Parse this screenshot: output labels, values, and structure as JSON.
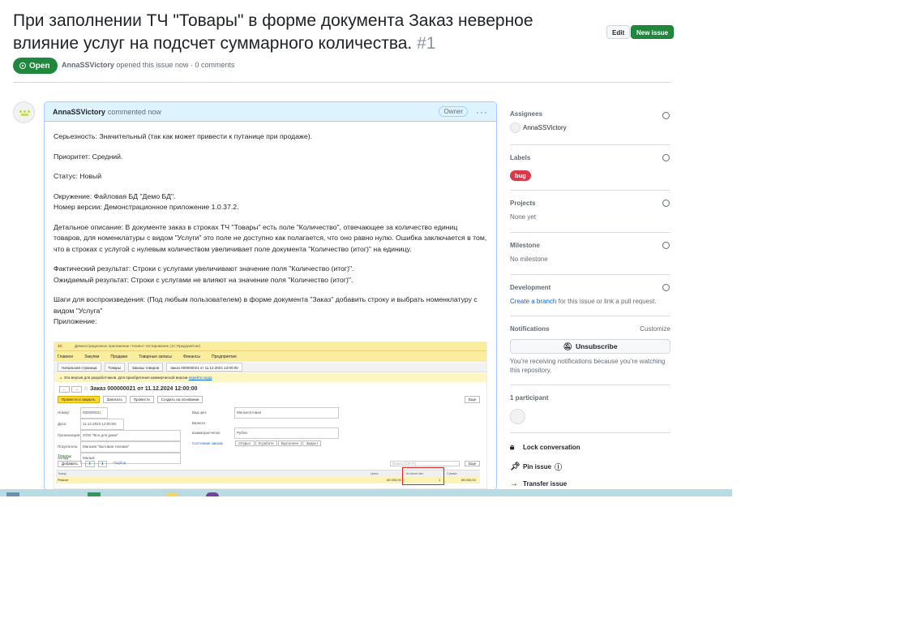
{
  "issue": {
    "title": "При заполнении ТЧ \"Товары\" в форме документа Заказ неверное влияние услуг на подсчет суммарного количества.",
    "number": "#1",
    "state": "Open",
    "author": "AnnaSSVictory",
    "meta": "opened this issue now · 0 comments"
  },
  "header_buttons": {
    "edit": "Edit",
    "new_issue": "New issue"
  },
  "comment": {
    "author": "AnnaSSVictory",
    "time": "commented now",
    "role": "Owner",
    "paragraphs": [
      "Серьезность: Значительный (так как может привести к путанице при продаже).",
      "Приоритет: Средний.",
      "Статус: Новый",
      "Окружение: Файловая БД \"Демо БД\".",
      "Номер версии: Демонстрационное приложение 1.0.37.2.",
      "Детальное описание: В документе заказ в строках ТЧ \"Товары\" есть поле \"Количество\", отвечающее за количество единиц товаров, для номенклатуры с видом \"Услуги\" это поле не доступно как полагается, что оно равно нулю. Ошибка заключается в том, что в строках с услугой с нулевым количеством увеличивает поле документа \"Количество (итог)\" на единицу.",
      "Фактический результат: Строки с услугами увеличивают значение поля \"Количество (итог)\".",
      "Ожидаемый результат: Строки с услугами не влияют на значение поля \"Количество (итог)\".",
      "Шаги для воспроизведения: (Под любым пользователем) в форме документа \"Заказ\" добавить строку и выбрать номенклатуру с видом \"Услуга\"",
      "Приложение:"
    ]
  },
  "screenshot": {
    "app_title": "Демонстрационное приложение / Клиент-тестирование (1С:Предприятие)",
    "menu": [
      "Главное",
      "Закупки",
      "Продажи",
      "Товарные запасы",
      "Финансы",
      "Предприятие"
    ],
    "tabs": [
      "Начальная страница",
      "Товары",
      "Заказы товаров",
      "Заказ 000000021 от 11.12.2024 12:00:00"
    ],
    "banner": "Эта версия для разработчиков. Для приобретения коммерческой версии",
    "banner_link": "перейти сюда",
    "doc_title": "Заказ 000000021 от 11.12.2024 12:00:00",
    "buttons": [
      "Провести и закрыть",
      "Записать",
      "Провести",
      "Создать на основании"
    ],
    "fields": {
      "number_label": "Номер:",
      "number": "000000021",
      "date_label": "Дата:",
      "date": "11.12.2024 12:00:00",
      "org_label": "Организация:",
      "org": "ООО \"Все для дома\"",
      "customer_label": "Покупатель:",
      "customer": "Магазин \"Бытовая техника\"",
      "warehouse_label": "Склад:",
      "warehouse": "Малый",
      "type_label": "Вид цен:",
      "type": "Мелкооптовая",
      "currency_label": "Валюта взаиморасчетов:",
      "currency": "Рубли",
      "state_label": "Состояние заказа:"
    },
    "status_buttons": [
      "Открыт",
      "В работе",
      "Выполнен",
      "Закрыт"
    ],
    "section": "Товары",
    "table_add": "Добавить",
    "table_pick": "Подбор",
    "search_placeholder": "Поиск (Ctrl+F)",
    "more": "Еще",
    "columns": [
      "Товар",
      "Цена",
      "Количество",
      "Сумма"
    ],
    "row": {
      "item": "Ремонт",
      "price": "65 000,00",
      "qty": "1",
      "sum": "65 000,00"
    }
  },
  "sidebar": {
    "assignees": {
      "label": "Assignees",
      "value": "AnnaSSVictory"
    },
    "labels": {
      "label": "Labels",
      "value": "bug"
    },
    "projects": {
      "label": "Projects",
      "value": "None yet"
    },
    "milestone": {
      "label": "Milestone",
      "value": "No milestone"
    },
    "development": {
      "label": "Development",
      "link": "Create a branch",
      "text": "for this issue or link a pull request."
    },
    "notifications": {
      "label": "Notifications",
      "customize": "Customize",
      "button": "Unsubscribe",
      "text": "You’re receiving notifications because you’re watching this repository."
    },
    "participants": {
      "label": "1 participant"
    },
    "actions": [
      "Lock conversation",
      "Pin issue",
      "Transfer issue"
    ]
  },
  "colors": {
    "open_green": "#1f883d",
    "bug_red": "#d73a4a",
    "link_blue": "#0969da",
    "comment_header": "#ddf4ff"
  }
}
